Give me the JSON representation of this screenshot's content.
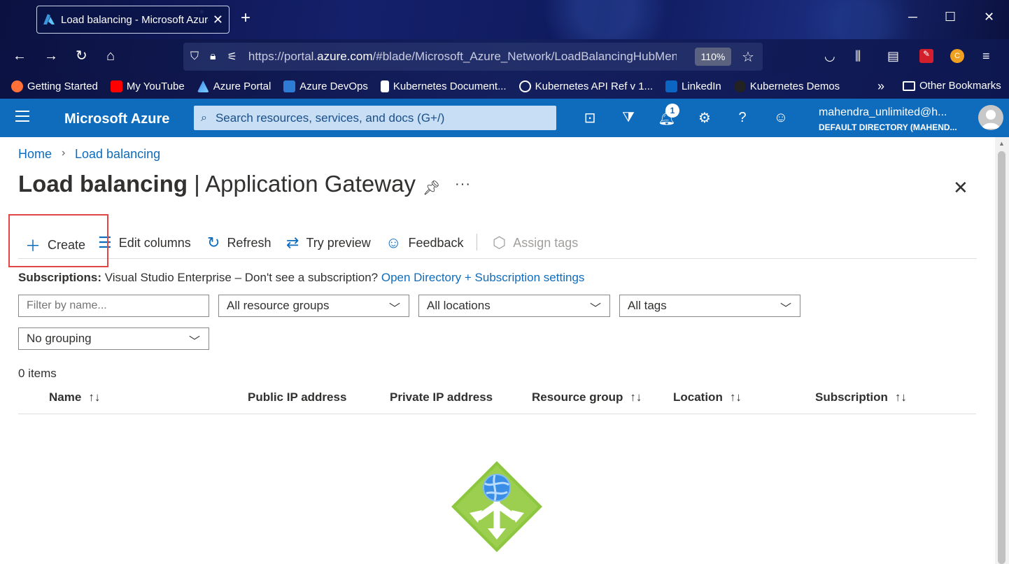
{
  "browser": {
    "tab_title": "Load balancing - Microsoft Azure",
    "url_prefix": "https://portal.",
    "url_domain": "azure.com",
    "url_suffix": "/#blade/Microsoft_Azure_Network/LoadBalancingHubMenuBlade",
    "zoom": "110%",
    "bookmarks": [
      {
        "label": "Getting Started",
        "icon": "firefox-icon",
        "color": "#ff7139"
      },
      {
        "label": "My YouTube",
        "icon": "youtube-icon",
        "color": "#ff0000"
      },
      {
        "label": "Azure Portal",
        "icon": "azure-icon",
        "color": "#3b8eea"
      },
      {
        "label": "Azure DevOps",
        "icon": "devops-icon",
        "color": "#2f7cd6"
      },
      {
        "label": "Kubernetes Document...",
        "icon": "document-icon",
        "color": "#ffffff"
      },
      {
        "label": "Kubernetes API Ref v 1...",
        "icon": "globe-icon",
        "color": "#ffffff"
      },
      {
        "label": "LinkedIn",
        "icon": "linkedin-icon",
        "color": "#0a66c2"
      },
      {
        "label": "Kubernetes Demos",
        "icon": "github-icon",
        "color": "#ffffff"
      }
    ],
    "other_bookmarks": "Other Bookmarks"
  },
  "azure": {
    "brand": "Microsoft Azure",
    "search_placeholder": "Search resources, services, and docs (G+/)",
    "notification_count": "1",
    "account_name": "mahendra_unlimited@h...",
    "account_directory": "DEFAULT DIRECTORY (MAHEND..."
  },
  "breadcrumb": {
    "home": "Home",
    "current": "Load balancing"
  },
  "page": {
    "title_bold": "Load balancing",
    "title_sep": " | ",
    "title_rest": "Application Gateway",
    "more": "···"
  },
  "commands": {
    "create": "Create",
    "edit_columns": "Edit columns",
    "refresh": "Refresh",
    "try_preview": "Try preview",
    "feedback": "Feedback",
    "assign_tags": "Assign tags"
  },
  "subscriptions": {
    "label": "Subscriptions:",
    "text": " Visual Studio Enterprise – Don't see a subscription? ",
    "link": "Open Directory + Subscription settings"
  },
  "filters": {
    "name_placeholder": "Filter by name...",
    "resource_groups": "All resource groups",
    "locations": "All locations",
    "tags": "All tags",
    "grouping": "No grouping"
  },
  "list": {
    "count": "0 items",
    "columns": [
      "Name",
      "Public IP address",
      "Private IP address",
      "Resource group",
      "Location",
      "Subscription"
    ]
  },
  "colors": {
    "azure_blue": "#0f6cbd",
    "highlight": "#e04848",
    "empty_icon_green": "#8dc63f"
  }
}
